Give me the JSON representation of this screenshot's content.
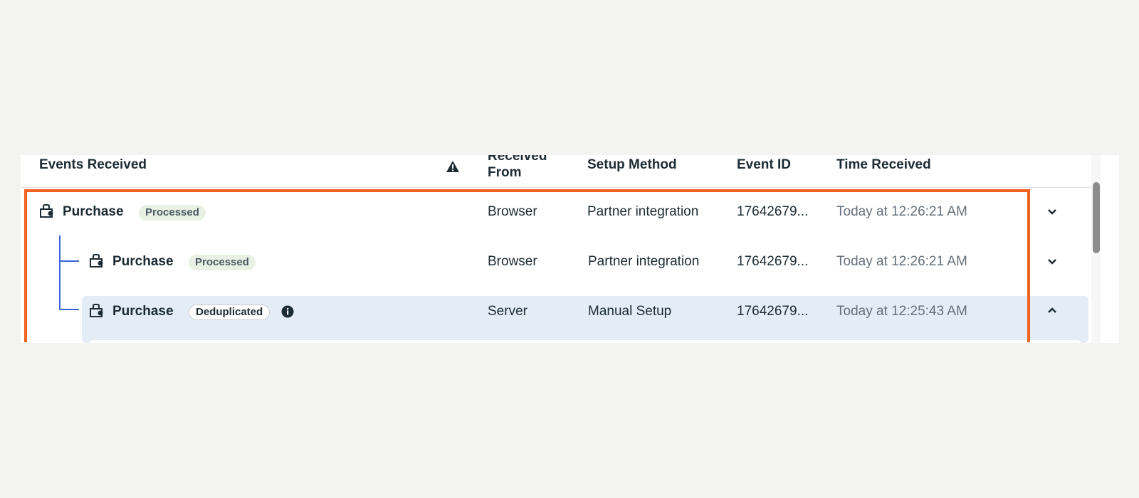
{
  "table": {
    "headers": {
      "events_received": "Events Received",
      "received_from_line1": "Received",
      "received_from_line2": "From",
      "setup_method": "Setup Method",
      "event_id": "Event ID",
      "time_received": "Time Received"
    },
    "rows": [
      {
        "name": "Purchase",
        "status": "Processed",
        "received_from": "Browser",
        "setup_method": "Partner integration",
        "event_id": "17642679...",
        "time_received": "Today at 12:26:21 AM",
        "expanded": false
      },
      {
        "name": "Purchase",
        "status": "Processed",
        "received_from": "Browser",
        "setup_method": "Partner integration",
        "event_id": "17642679...",
        "time_received": "Today at 12:26:21 AM",
        "expanded": false
      },
      {
        "name": "Purchase",
        "status": "Deduplicated",
        "received_from": "Server",
        "setup_method": "Manual Setup",
        "event_id": "17642679...",
        "time_received": "Today at 12:25:43 AM",
        "expanded": true
      }
    ]
  },
  "icons": {
    "warning": "warning-icon",
    "bag": "shopping-bag-icon",
    "info": "info-icon",
    "chevron_down": "chevron-down-icon",
    "chevron_up": "chevron-up-icon"
  },
  "colors": {
    "highlight_frame": "#f0621f",
    "tree_line": "#3b63d6",
    "selected_row": "#e4ecf6",
    "processed_badge": "#e8f1e4"
  }
}
